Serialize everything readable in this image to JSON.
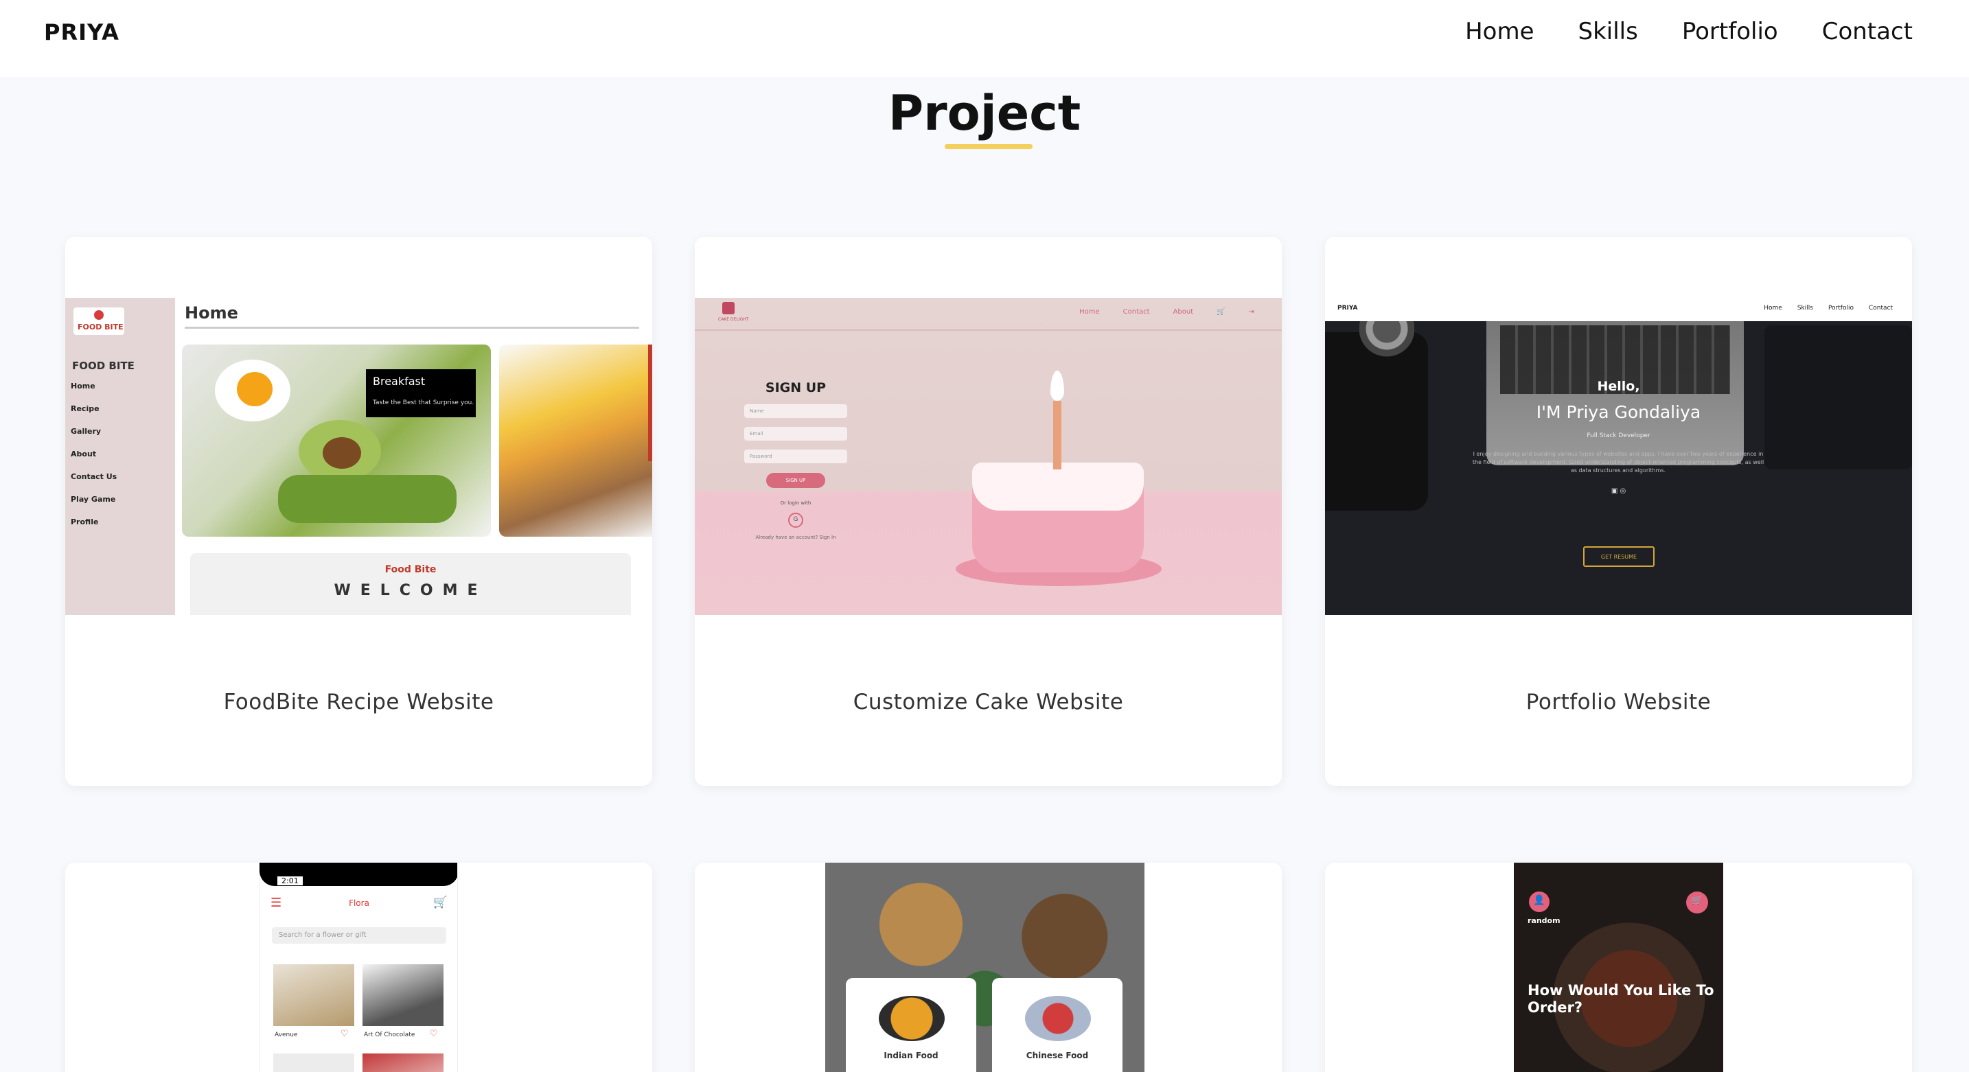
{
  "brand": "PRIYA",
  "nav": [
    "Home",
    "Skills",
    "Portfolio",
    "Contact"
  ],
  "section_title": "Project",
  "colors": {
    "accent": "#f5cf5c",
    "page_bg": "#f8f9fc",
    "card_bg": "#ffffff"
  },
  "projects": [
    {
      "title": "FoodBite Recipe Website",
      "preview": {
        "logo": "FOOD BITE",
        "brand": "FOOD BITE",
        "menu": [
          "Home",
          "Recipe",
          "Gallery",
          "About",
          "Contact Us",
          "Play Game",
          "Profile"
        ],
        "heading": "Home",
        "card_title": "Breakfast",
        "card_sub": "Taste the Best that Surprise you.",
        "welcome_small": "Food Bite",
        "welcome": "WELCOME"
      }
    },
    {
      "title": "Customize Cake Website",
      "preview": {
        "logo": "CAKE DELIGHT",
        "nav": [
          "Home",
          "Contact",
          "About"
        ],
        "heading": "SIGN UP",
        "fields": [
          "Name",
          "Email",
          "Password"
        ],
        "button": "SIGN UP",
        "or": "Or login with",
        "google": "G",
        "account": "Already have an account? Sign In"
      }
    },
    {
      "title": "Portfolio Website",
      "preview": {
        "brand": "PRIYA",
        "nav": [
          "Home",
          "Skills",
          "Portfolio",
          "Contact"
        ],
        "hello": "Hello,",
        "name": "I'M Priya Gondaliya",
        "role": "Full Stack Developer",
        "desc": "I enjoy designing and building various types of websites and apps. I have over two years of experience in the field of software development. Good understanding of object-oriented programming concepts, as well as data structures and algorithms.",
        "icons": "▣ ◎",
        "button": "GET RESUME"
      }
    },
    {
      "title": "",
      "preview": {
        "time": "2:01",
        "app": "Flora",
        "search": "Search for a flower or gift",
        "items": [
          "Avenue",
          "Art Of Chocolate"
        ]
      }
    },
    {
      "title": "",
      "preview": {
        "items": [
          "Indian Food",
          "Chinese Food"
        ]
      }
    },
    {
      "title": "",
      "preview": {
        "user": "random",
        "question": "How Would You Like To Order?"
      }
    }
  ]
}
